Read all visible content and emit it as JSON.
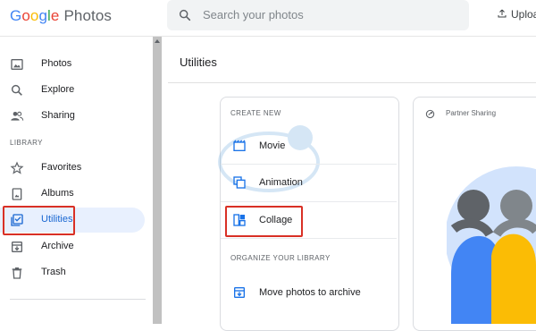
{
  "header": {
    "logo_letters": [
      "G",
      "o",
      "o",
      "g",
      "l",
      "e"
    ],
    "logo_product": "Photos",
    "search_placeholder": "Search your photos",
    "upload_label": "Uploa"
  },
  "sidebar": {
    "items_top": [
      {
        "label": "Photos",
        "icon": "photo-icon"
      },
      {
        "label": "Explore",
        "icon": "search-icon"
      },
      {
        "label": "Sharing",
        "icon": "people-icon"
      }
    ],
    "library_label": "LIBRARY",
    "library_items": [
      {
        "label": "Favorites",
        "icon": "star-icon"
      },
      {
        "label": "Albums",
        "icon": "album-icon"
      },
      {
        "label": "Utilities",
        "icon": "utilities-icon",
        "active": true
      },
      {
        "label": "Archive",
        "icon": "archive-icon"
      },
      {
        "label": "Trash",
        "icon": "trash-icon"
      }
    ]
  },
  "main": {
    "title": "Utilities",
    "create_new": {
      "section_label": "CREATE NEW",
      "items": [
        {
          "label": "Movie",
          "icon": "movie-icon"
        },
        {
          "label": "Animation",
          "icon": "animation-icon"
        },
        {
          "label": "Collage",
          "icon": "collage-icon"
        }
      ]
    },
    "organize": {
      "section_label": "ORGANIZE YOUR LIBRARY",
      "items": [
        {
          "label": "Move photos to archive",
          "icon": "archive-move-icon"
        }
      ]
    },
    "partner": {
      "title": "Partner Sharing",
      "icon": "partner-sharing-icon"
    }
  },
  "colors": {
    "accent": "#1a73e8",
    "active_bg": "#e8f0fe",
    "highlight": "#d93025"
  }
}
